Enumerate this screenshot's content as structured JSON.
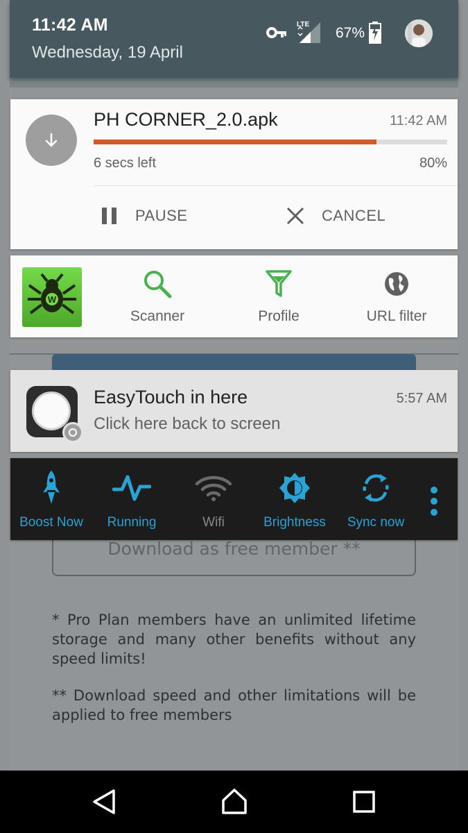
{
  "status_bar": {
    "time": "11:42 AM",
    "date": "Wednesday, 19 April",
    "network": "LTE",
    "battery": "67%"
  },
  "download": {
    "filename": "PH CORNER_2.0.apk",
    "time": "11:42 AM",
    "time_left": "6 secs left",
    "percent_label": "80%",
    "progress": 0.8,
    "progress_color": "#d2592c",
    "pause_label": "PAUSE",
    "cancel_label": "CANCEL"
  },
  "security": {
    "items": [
      {
        "label": "Scanner",
        "icon": "magnifier-icon"
      },
      {
        "label": "Profile",
        "icon": "filter-icon"
      },
      {
        "label": "URL filter",
        "icon": "globe-icon"
      }
    ],
    "accent": "#4caf50"
  },
  "easytouch": {
    "title": "EasyTouch in here",
    "time": "5:57 AM",
    "subtitle": "Click here back to screen"
  },
  "toolbar": {
    "accent": "#29a3d6",
    "items": [
      {
        "label": "Boost Now",
        "icon": "rocket-icon",
        "active": true
      },
      {
        "label": "Running",
        "icon": "pulse-icon",
        "active": true
      },
      {
        "label": "Wifi",
        "icon": "wifi-icon",
        "active": false
      },
      {
        "label": "Brightness",
        "icon": "brightness-icon",
        "active": true
      },
      {
        "label": "Sync now",
        "icon": "sync-icon",
        "active": true
      }
    ]
  },
  "background_page": {
    "download_button": "Download as free member **",
    "note1": "* Pro Plan members have an unlimited lifetime storage and many other benefits without any speed limits!",
    "note2": "** Download speed and other limitations will be applied to free members"
  }
}
